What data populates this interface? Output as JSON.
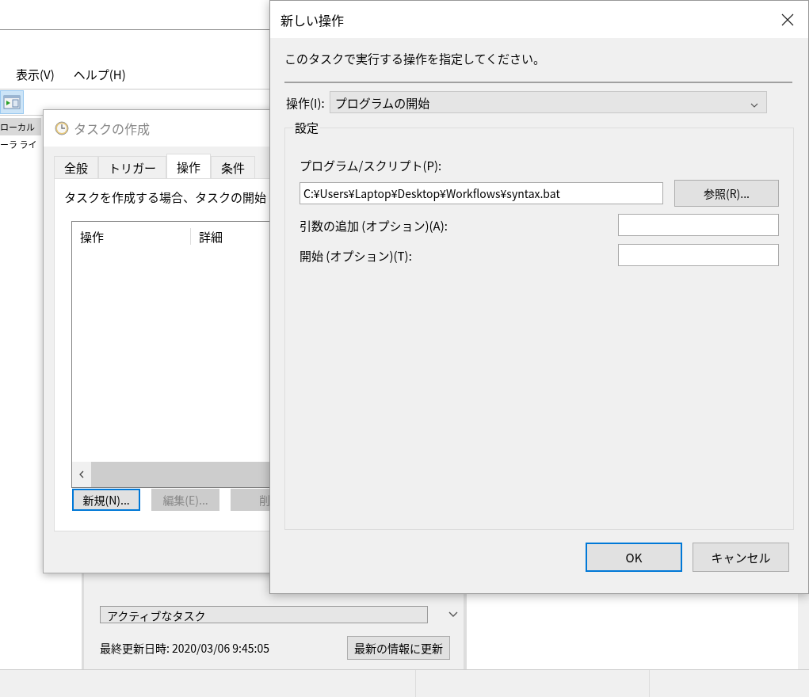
{
  "main_window": {
    "menu": [
      {
        "label": "表示(V)"
      },
      {
        "label": "ヘルプ(H)"
      }
    ],
    "tree": [
      {
        "label": "ローカル",
        "selected": true
      },
      {
        "label": "ーラ ライ",
        "selected": false
      }
    ],
    "section": "アクティブなタスク",
    "updated": "最終更新日時: 2020/03/06 9:45:05",
    "refresh_button": "最新の情報に更新"
  },
  "create_task_dialog": {
    "title": "タスクの作成",
    "tabs": [
      {
        "label": "全般",
        "selected": false
      },
      {
        "label": "トリガー",
        "selected": false
      },
      {
        "label": "操作",
        "selected": true
      },
      {
        "label": "条件",
        "selected": false
      }
    ],
    "description": "タスクを作成する場合、タスクの開始",
    "columns": [
      "操作",
      "詳細"
    ],
    "buttons": [
      {
        "label": "新規(N)...",
        "focused": true,
        "disabled": false
      },
      {
        "label": "編集(E)...",
        "focused": false,
        "disabled": true
      },
      {
        "label": "削",
        "focused": false,
        "disabled": true
      }
    ]
  },
  "new_action_dialog": {
    "title": "新しい操作",
    "instruction": "このタスクで実行する操作を指定してください。",
    "action_label": "操作(I):",
    "action_value": "プログラムの開始",
    "group_label": "設定",
    "program_label": "プログラム/スクリプト(P):",
    "program_value": "C:¥Users¥Laptop¥Desktop¥Workflows¥syntax.bat",
    "browse_button": "参照(R)...",
    "options": [
      {
        "label": "引数の追加 (オプション)(A):"
      },
      {
        "label": "開始 (オプション)(T):"
      }
    ],
    "buttons": [
      {
        "label": "OK",
        "focused": true
      },
      {
        "label": "キャンセル",
        "focused": false
      }
    ]
  }
}
